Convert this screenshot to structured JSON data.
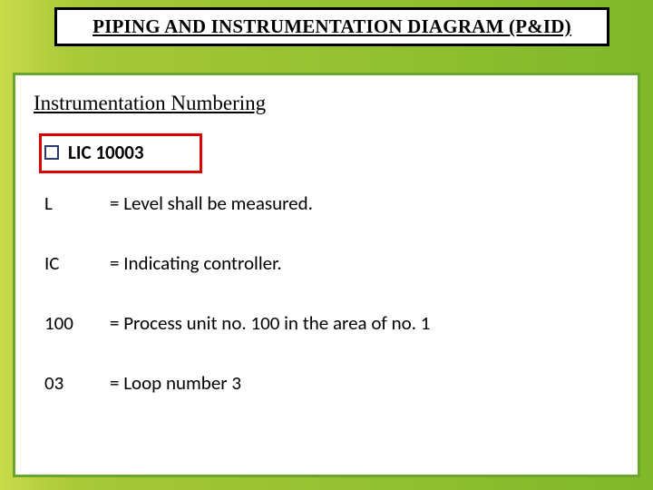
{
  "title": "PIPING AND INSTRUMENTATION DIAGRAM (P&ID)",
  "section_heading": "Instrumentation Numbering",
  "bullet": {
    "label": "LIC 10003"
  },
  "defs": [
    {
      "key": "L",
      "val": "= Level shall be measured."
    },
    {
      "key": "IC",
      "val": "= Indicating controller."
    },
    {
      "key": "100",
      "val": "= Process unit no. 100 in the area of no. 1"
    },
    {
      "key": "03",
      "val": "= Loop number 3"
    }
  ]
}
